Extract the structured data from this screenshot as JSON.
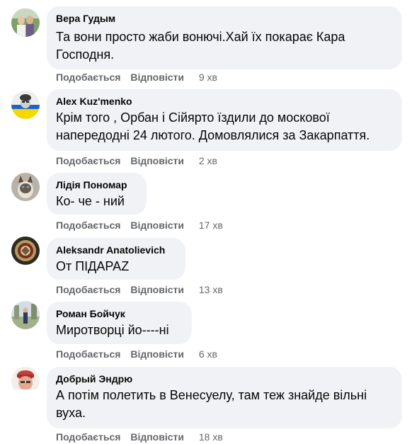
{
  "comments": [
    {
      "author": "Вера Гудым",
      "text": "Та вони просто жаби вонючі.Хай їх покарає Кара Господня.",
      "like_label": "Подобається",
      "reply_label": "Відповісти",
      "time": "9 хв"
    },
    {
      "author": "Alex Kuz'menko",
      "text": "Крім того , Орбан і Сійярто їздили до москової напередодні 24 лютого. Домовлялися за Закарпаття.",
      "like_label": "Подобається",
      "reply_label": "Відповісти",
      "time": "2 хв"
    },
    {
      "author": "Лідія Пономар",
      "text": "Ко- че - ний",
      "like_label": "Подобається",
      "reply_label": "Відповісти",
      "time": "17 хв"
    },
    {
      "author": "Aleksandr Anatolievich",
      "text": "От ПІДАРАZ",
      "like_label": "Подобається",
      "reply_label": "Відповісти",
      "time": "13 хв"
    },
    {
      "author": "Роман Бойчук",
      "text": "Миротворці йо----ні",
      "like_label": "Подобається",
      "reply_label": "Відповісти",
      "time": "6 хв"
    },
    {
      "author": "Добрый Эндрю",
      "text": "А потім полетить в Венесуелу, там теж знайде вільні вуха.",
      "like_label": "Подобається",
      "reply_label": "Відповісти",
      "time": "18 хв"
    }
  ]
}
